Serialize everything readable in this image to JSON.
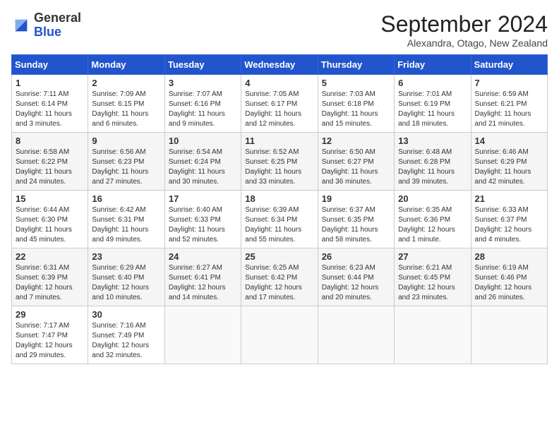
{
  "logo": {
    "general": "General",
    "blue": "Blue"
  },
  "title": "September 2024",
  "subtitle": "Alexandra, Otago, New Zealand",
  "days_of_week": [
    "Sunday",
    "Monday",
    "Tuesday",
    "Wednesday",
    "Thursday",
    "Friday",
    "Saturday"
  ],
  "weeks": [
    [
      {
        "day": "1",
        "info": "Sunrise: 7:11 AM\nSunset: 6:14 PM\nDaylight: 11 hours and 3 minutes."
      },
      {
        "day": "2",
        "info": "Sunrise: 7:09 AM\nSunset: 6:15 PM\nDaylight: 11 hours and 6 minutes."
      },
      {
        "day": "3",
        "info": "Sunrise: 7:07 AM\nSunset: 6:16 PM\nDaylight: 11 hours and 9 minutes."
      },
      {
        "day": "4",
        "info": "Sunrise: 7:05 AM\nSunset: 6:17 PM\nDaylight: 11 hours and 12 minutes."
      },
      {
        "day": "5",
        "info": "Sunrise: 7:03 AM\nSunset: 6:18 PM\nDaylight: 11 hours and 15 minutes."
      },
      {
        "day": "6",
        "info": "Sunrise: 7:01 AM\nSunset: 6:19 PM\nDaylight: 11 hours and 18 minutes."
      },
      {
        "day": "7",
        "info": "Sunrise: 6:59 AM\nSunset: 6:21 PM\nDaylight: 11 hours and 21 minutes."
      }
    ],
    [
      {
        "day": "8",
        "info": "Sunrise: 6:58 AM\nSunset: 6:22 PM\nDaylight: 11 hours and 24 minutes."
      },
      {
        "day": "9",
        "info": "Sunrise: 6:56 AM\nSunset: 6:23 PM\nDaylight: 11 hours and 27 minutes."
      },
      {
        "day": "10",
        "info": "Sunrise: 6:54 AM\nSunset: 6:24 PM\nDaylight: 11 hours and 30 minutes."
      },
      {
        "day": "11",
        "info": "Sunrise: 6:52 AM\nSunset: 6:25 PM\nDaylight: 11 hours and 33 minutes."
      },
      {
        "day": "12",
        "info": "Sunrise: 6:50 AM\nSunset: 6:27 PM\nDaylight: 11 hours and 36 minutes."
      },
      {
        "day": "13",
        "info": "Sunrise: 6:48 AM\nSunset: 6:28 PM\nDaylight: 11 hours and 39 minutes."
      },
      {
        "day": "14",
        "info": "Sunrise: 6:46 AM\nSunset: 6:29 PM\nDaylight: 11 hours and 42 minutes."
      }
    ],
    [
      {
        "day": "15",
        "info": "Sunrise: 6:44 AM\nSunset: 6:30 PM\nDaylight: 11 hours and 45 minutes."
      },
      {
        "day": "16",
        "info": "Sunrise: 6:42 AM\nSunset: 6:31 PM\nDaylight: 11 hours and 49 minutes."
      },
      {
        "day": "17",
        "info": "Sunrise: 6:40 AM\nSunset: 6:33 PM\nDaylight: 11 hours and 52 minutes."
      },
      {
        "day": "18",
        "info": "Sunrise: 6:39 AM\nSunset: 6:34 PM\nDaylight: 11 hours and 55 minutes."
      },
      {
        "day": "19",
        "info": "Sunrise: 6:37 AM\nSunset: 6:35 PM\nDaylight: 11 hours and 58 minutes."
      },
      {
        "day": "20",
        "info": "Sunrise: 6:35 AM\nSunset: 6:36 PM\nDaylight: 12 hours and 1 minute."
      },
      {
        "day": "21",
        "info": "Sunrise: 6:33 AM\nSunset: 6:37 PM\nDaylight: 12 hours and 4 minutes."
      }
    ],
    [
      {
        "day": "22",
        "info": "Sunrise: 6:31 AM\nSunset: 6:39 PM\nDaylight: 12 hours and 7 minutes."
      },
      {
        "day": "23",
        "info": "Sunrise: 6:29 AM\nSunset: 6:40 PM\nDaylight: 12 hours and 10 minutes."
      },
      {
        "day": "24",
        "info": "Sunrise: 6:27 AM\nSunset: 6:41 PM\nDaylight: 12 hours and 14 minutes."
      },
      {
        "day": "25",
        "info": "Sunrise: 6:25 AM\nSunset: 6:42 PM\nDaylight: 12 hours and 17 minutes."
      },
      {
        "day": "26",
        "info": "Sunrise: 6:23 AM\nSunset: 6:44 PM\nDaylight: 12 hours and 20 minutes."
      },
      {
        "day": "27",
        "info": "Sunrise: 6:21 AM\nSunset: 6:45 PM\nDaylight: 12 hours and 23 minutes."
      },
      {
        "day": "28",
        "info": "Sunrise: 6:19 AM\nSunset: 6:46 PM\nDaylight: 12 hours and 26 minutes."
      }
    ],
    [
      {
        "day": "29",
        "info": "Sunrise: 7:17 AM\nSunset: 7:47 PM\nDaylight: 12 hours and 29 minutes."
      },
      {
        "day": "30",
        "info": "Sunrise: 7:16 AM\nSunset: 7:49 PM\nDaylight: 12 hours and 32 minutes."
      },
      {
        "day": "",
        "info": ""
      },
      {
        "day": "",
        "info": ""
      },
      {
        "day": "",
        "info": ""
      },
      {
        "day": "",
        "info": ""
      },
      {
        "day": "",
        "info": ""
      }
    ]
  ]
}
